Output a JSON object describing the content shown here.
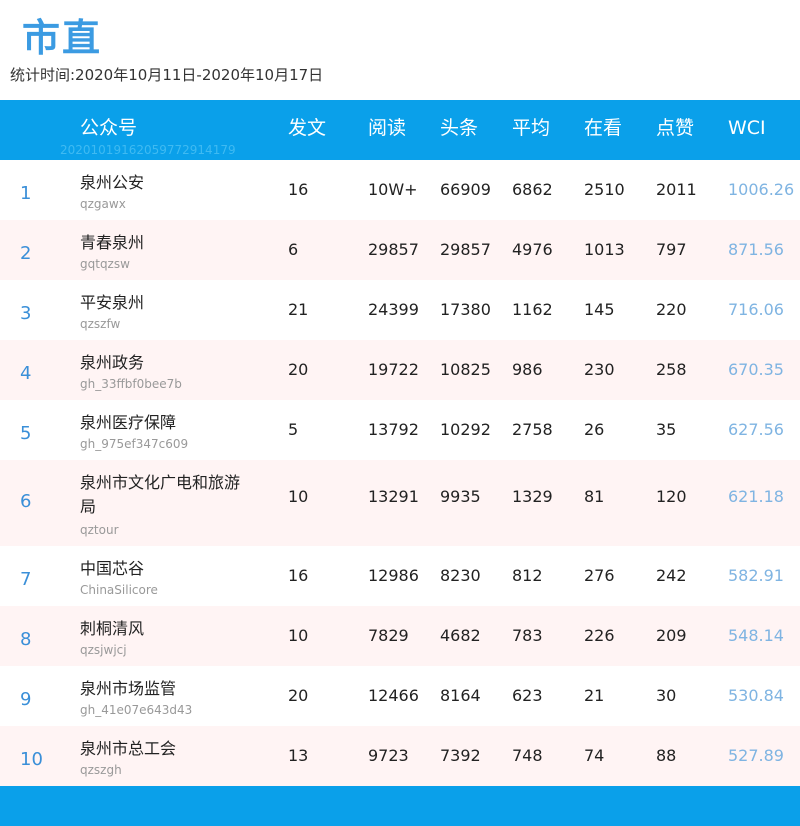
{
  "title": "市直",
  "period": "统计时间:2020年10月11日-2020年10月17日",
  "header": {
    "columns": [
      "公众号",
      "发文",
      "阅读",
      "头条",
      "平均",
      "在看",
      "点赞",
      "WCI"
    ],
    "id_text": "20201019162059772914179"
  },
  "rows": [
    {
      "rank": "1",
      "name": "泉州公安",
      "account": "qzgawx",
      "posts": "16",
      "reads": "10W+",
      "headline": "66909",
      "avg": "6862",
      "watching": "2510",
      "likes": "2011",
      "wci": "1006.26"
    },
    {
      "rank": "2",
      "name": "青春泉州",
      "account": "gqtqzsw",
      "posts": "6",
      "reads": "29857",
      "headline": "29857",
      "avg": "4976",
      "watching": "1013",
      "likes": "797",
      "wci": "871.56"
    },
    {
      "rank": "3",
      "name": "平安泉州",
      "account": "qzszfw",
      "posts": "21",
      "reads": "24399",
      "headline": "17380",
      "avg": "1162",
      "watching": "145",
      "likes": "220",
      "wci": "716.06"
    },
    {
      "rank": "4",
      "name": "泉州政务",
      "account": "gh_33ffbf0bee7b",
      "posts": "20",
      "reads": "19722",
      "headline": "10825",
      "avg": "986",
      "watching": "230",
      "likes": "258",
      "wci": "670.35"
    },
    {
      "rank": "5",
      "name": "泉州医疗保障",
      "account": "gh_975ef347c609",
      "posts": "5",
      "reads": "13792",
      "headline": "10292",
      "avg": "2758",
      "watching": "26",
      "likes": "35",
      "wci": "627.56"
    },
    {
      "rank": "6",
      "name": "泉州市文化广电和旅游局",
      "account": "qztour",
      "posts": "10",
      "reads": "13291",
      "headline": "9935",
      "avg": "1329",
      "watching": "81",
      "likes": "120",
      "wci": "621.18"
    },
    {
      "rank": "7",
      "name": "中国芯谷",
      "account": "ChinaSilicore",
      "posts": "16",
      "reads": "12986",
      "headline": "8230",
      "avg": "812",
      "watching": "276",
      "likes": "242",
      "wci": "582.91"
    },
    {
      "rank": "8",
      "name": "刺桐清风",
      "account": "qzsjwjcj",
      "posts": "10",
      "reads": "7829",
      "headline": "4682",
      "avg": "783",
      "watching": "226",
      "likes": "209",
      "wci": "548.14"
    },
    {
      "rank": "9",
      "name": "泉州市场监管",
      "account": "gh_41e07e643d43",
      "posts": "20",
      "reads": "12466",
      "headline": "8164",
      "avg": "623",
      "watching": "21",
      "likes": "30",
      "wci": "530.84"
    },
    {
      "rank": "10",
      "name": "泉州市总工会",
      "account": "qzszgh",
      "posts": "13",
      "reads": "9723",
      "headline": "7392",
      "avg": "748",
      "watching": "74",
      "likes": "88",
      "wci": "527.89"
    }
  ],
  "colors": {
    "accent": "#0aa0ea",
    "title": "#3b9be2",
    "rank": "#3a8fd8",
    "wci": "#7fb4e2",
    "alt_row": "#fff4f4"
  }
}
